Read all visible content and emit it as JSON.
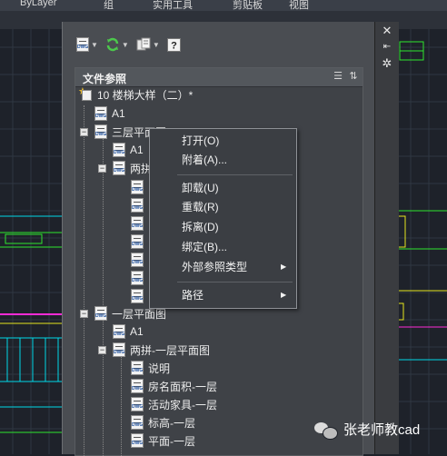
{
  "ribbon": {
    "items": [
      "ByLayer",
      "组",
      "实用工具",
      "剪贴板",
      "视图"
    ]
  },
  "toolbar": {
    "buttons": [
      {
        "name": "attach-dwg",
        "icon": "dwg-file-icon",
        "has_dropdown": true
      },
      {
        "name": "refresh",
        "icon": "refresh-icon",
        "has_dropdown": true
      },
      {
        "name": "change-path",
        "icon": "path-icon",
        "has_dropdown": true
      },
      {
        "name": "help",
        "icon": "help-icon",
        "has_dropdown": false
      }
    ]
  },
  "panel": {
    "title": "文件参照"
  },
  "tree": {
    "root": "10 楼梯大样（二）*",
    "items": [
      {
        "label": "A1"
      },
      {
        "label": "三层平面图"
      },
      {
        "label": "A1"
      },
      {
        "label": "两拼"
      },
      {
        "label": "一层平面图"
      },
      {
        "label": "A1"
      },
      {
        "label": "两拼-一层平面图"
      },
      {
        "label": "说明"
      },
      {
        "label": "房名面积-一层"
      },
      {
        "label": "活动家具-一层"
      },
      {
        "label": "标高-一层"
      },
      {
        "label": "平面-一层"
      }
    ]
  },
  "context_menu": {
    "items": [
      "打开(O)",
      "附着(A)...",
      "卸载(U)",
      "重载(R)",
      "拆离(D)",
      "绑定(B)...",
      "外部参照类型",
      "路径"
    ]
  },
  "watermark": {
    "text": "张老师教cad"
  },
  "colors": {
    "cad_background": "#1e222a",
    "grid_line": "#2f3742",
    "cyan": "#00d8e8",
    "green": "#2ee62e",
    "magenta": "#ff2bd6",
    "yellow": "#e6e61e"
  }
}
